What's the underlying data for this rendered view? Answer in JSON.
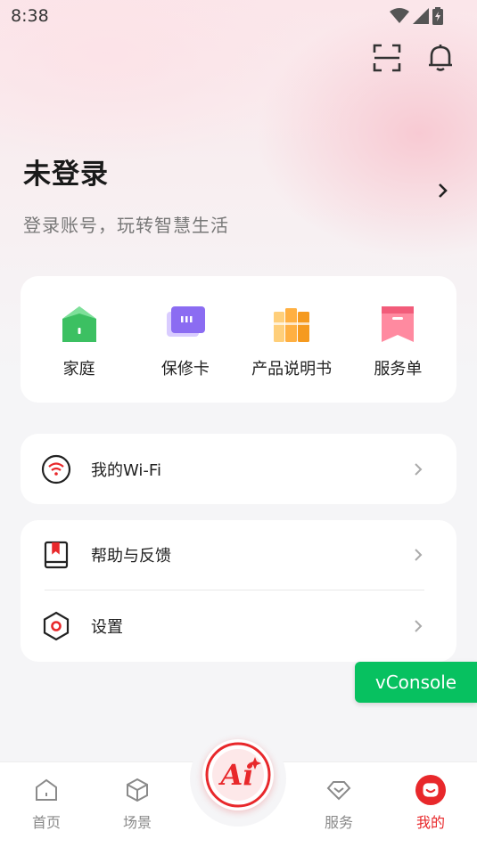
{
  "status_bar": {
    "time": "8:38"
  },
  "profile": {
    "title": "未登录",
    "subtitle": "登录账号，玩转智慧生活"
  },
  "quick_actions": [
    {
      "label": "家庭",
      "icon": "home-icon"
    },
    {
      "label": "保修卡",
      "icon": "warranty-card-icon"
    },
    {
      "label": "产品说明书",
      "icon": "manual-books-icon"
    },
    {
      "label": "服务单",
      "icon": "service-order-icon"
    }
  ],
  "menu": {
    "wifi": {
      "label": "我的Wi-Fi",
      "icon": "wifi-icon"
    },
    "help": {
      "label": "帮助与反馈",
      "icon": "book-icon"
    },
    "settings": {
      "label": "设置",
      "icon": "hexagon-settings-icon"
    }
  },
  "vconsole": {
    "label": "vConsole"
  },
  "tabbar": {
    "items": [
      {
        "label": "首页",
        "icon": "home-outline-icon"
      },
      {
        "label": "场景",
        "icon": "cube-icon"
      },
      {
        "label": "服务",
        "icon": "heart-diamond-icon"
      },
      {
        "label": "我的",
        "icon": "smile-icon",
        "active": true
      }
    ],
    "center": {
      "label": "Ai"
    }
  },
  "colors": {
    "accent": "#e8282b",
    "vconsole": "#07c160",
    "background": "#f5f5f7"
  }
}
